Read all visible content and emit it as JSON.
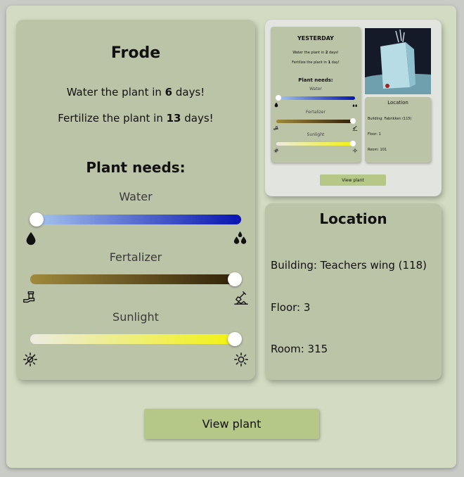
{
  "plant": {
    "name": "Frode",
    "water_prefix": "Water the plant in ",
    "water_days": "6",
    "water_suffix": " days!",
    "fert_prefix": "Fertilize the plant in ",
    "fert_days": "13",
    "fert_suffix": " days!"
  },
  "needs": {
    "heading": "Plant needs:",
    "water": {
      "label": "Water",
      "level": 0.03,
      "colors": [
        "#a9c8ee",
        "#0814b0"
      ]
    },
    "fertalizer": {
      "label": "Fertalizer",
      "level": 0.97,
      "colors": [
        "#a08a3c",
        "#2e1f08"
      ]
    },
    "sunlight": {
      "label": "Sunlight",
      "level": 0.97,
      "colors": [
        "#ecebe3",
        "#f2f20a"
      ]
    }
  },
  "location": {
    "title": "Location",
    "building": "Building: Teachers wing (118)",
    "floor": "Floor: 3",
    "room": "Room: 315"
  },
  "button": {
    "label": "View plant"
  },
  "thumbnail": {
    "name": "YESTERDAY",
    "water_prefix": "Water the plant in ",
    "water_days": "2",
    "water_suffix": " days!",
    "fert_prefix": "Fertilize the plant in ",
    "fert_days": "1",
    "fert_suffix": " day!",
    "needs_heading": "Plant needs:",
    "water_label": "Water",
    "fert_label": "Fertalizer",
    "sun_label": "Sunlight",
    "water_level": 0.03,
    "fert_level": 0.97,
    "sun_level": 0.97,
    "location_title": "Location",
    "building": "Building: Fabrikken (115)",
    "floor": "Floor: 1",
    "room": "Room: 101",
    "button_label": "View plant"
  }
}
